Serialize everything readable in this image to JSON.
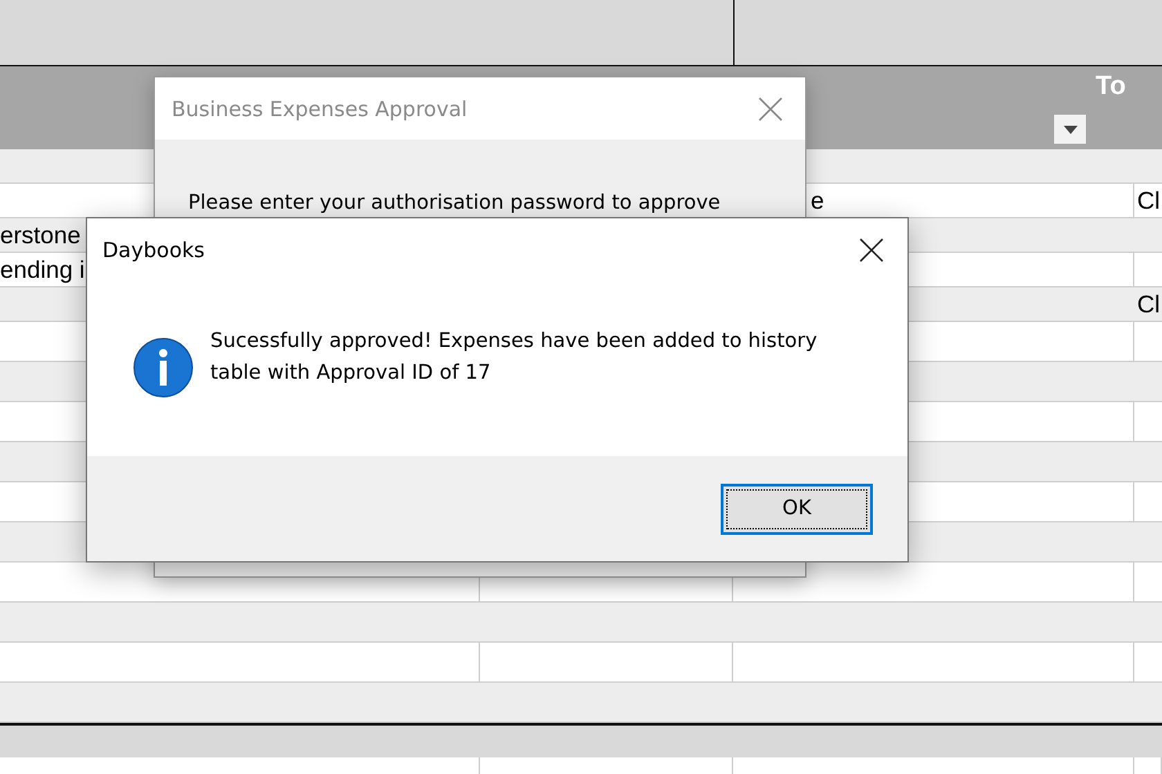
{
  "table": {
    "header": {
      "column_4": "To"
    },
    "rows": [
      {
        "column_3": "e",
        "column_4": "Cl"
      },
      {
        "column_1": "erstone"
      },
      {
        "column_1": "ending i"
      },
      {
        "column_4": "Cl"
      }
    ]
  },
  "approval_dialog": {
    "title": "Business Expenses Approval",
    "message": "Please enter your authorisation password to approve"
  },
  "message_box": {
    "title": "Daybooks",
    "message": "Sucessfully approved! Expenses have been added to history table with Approval ID of 17",
    "buttons": [
      {
        "label": "OK",
        "focused": true
      }
    ]
  }
}
